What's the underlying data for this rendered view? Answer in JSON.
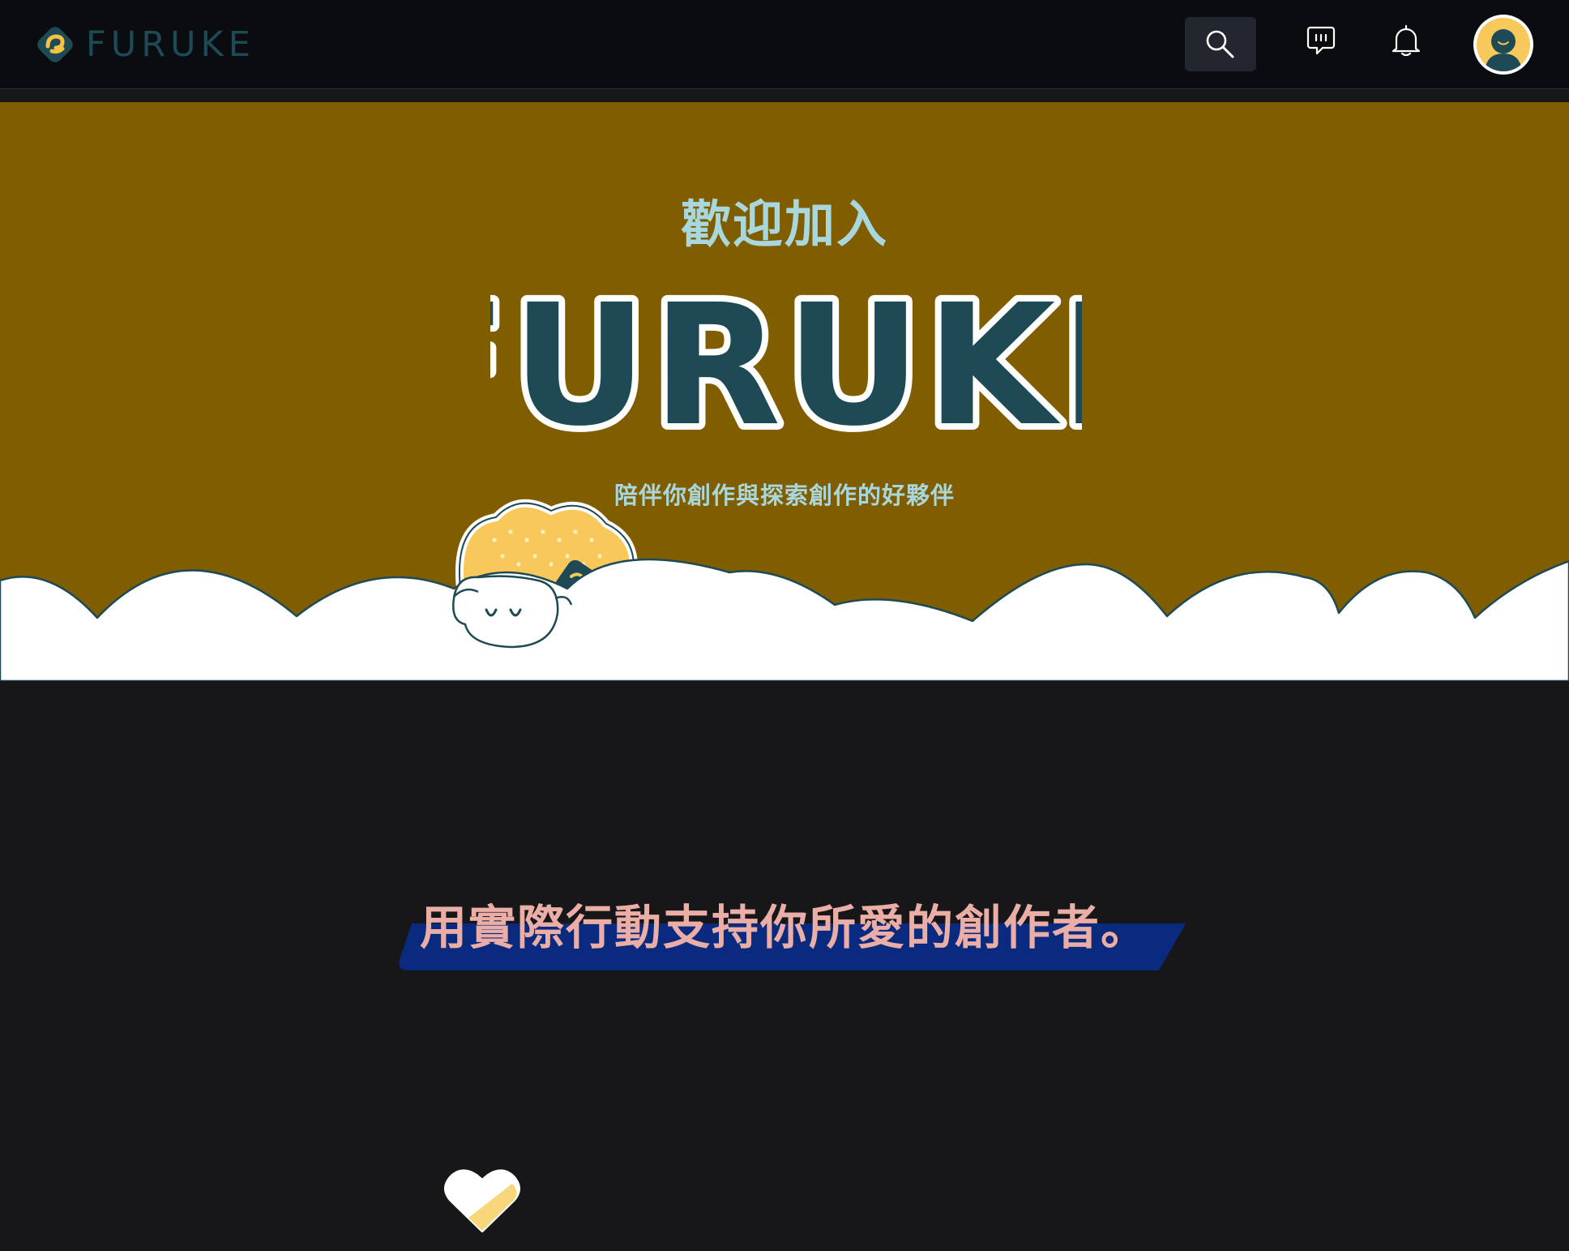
{
  "nav": {
    "brand_name": "FURUKE",
    "brand_color": "#1d4a55",
    "background": "#0b0c10",
    "search_icon": "search-icon",
    "message_icon": "message-icon",
    "notification_icon": "bell-icon",
    "avatar_icon": "user-avatar-icon"
  },
  "hero": {
    "welcome": "歡迎加入",
    "logo_text": "FURUKE",
    "tagline": "陪伴你創作與探索創作的好夥伴",
    "background": "#805e00",
    "text_color": "#a8d7de",
    "mascot": "sheep-mascot"
  },
  "section": {
    "slogan": "用實際行動支持你所愛的創作者。",
    "slogan_color": "#eaaea6",
    "highlight_color": "#0a2a80",
    "heart_icon": "heart-icon"
  }
}
